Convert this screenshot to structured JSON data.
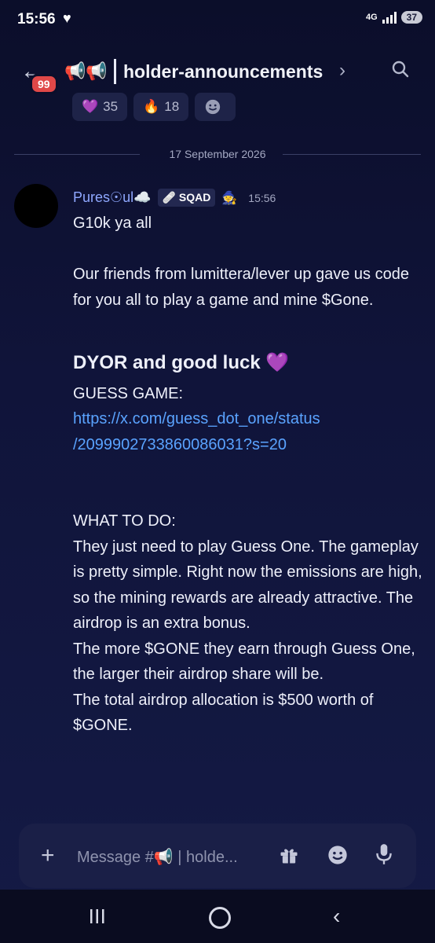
{
  "status": {
    "time": "15:56",
    "network": "4G",
    "battery": "37"
  },
  "header": {
    "unread_badge": "99",
    "channel_icons": "📢📢",
    "channel_name": "holder-announcements",
    "chevron": "›"
  },
  "reactions": [
    {
      "emoji": "💜",
      "count": "35"
    },
    {
      "emoji": "🔥",
      "count": "18"
    }
  ],
  "divider": {
    "date": "17 September 2026"
  },
  "message": {
    "author": "Pures☉ul☁️",
    "role_tag": "SQAD",
    "role_glyph": "🩹",
    "wizard": "🧙",
    "time": "15:56",
    "greeting": "G10k ya all",
    "intro": "Our friends from lumittera/lever up gave us code for you all to play a game and mine $Gone.",
    "heading": "DYOR and good luck 💜",
    "game_label": "GUESS GAME:",
    "game_link_1": "https://x.com/guess_dot_one/status",
    "game_link_2": "/2099902733860086031?s=20",
    "todo_label": "WHAT TO DO:",
    "todo_1": "They just need to play Guess One. The gameplay is pretty simple. Right now the emissions are high, so the mining rewards are already attractive. The airdrop is an extra bonus.",
    "todo_2": "The more $GONE they earn through Guess One, the larger their airdrop share will be.",
    "todo_3": "The total airdrop allocation is $500 worth of $GONE."
  },
  "composer": {
    "placeholder": "Message #📢 | holde..."
  },
  "colors": {
    "link": "#5aa3ff",
    "author": "#8fa8ff",
    "badge": "#e04848"
  }
}
